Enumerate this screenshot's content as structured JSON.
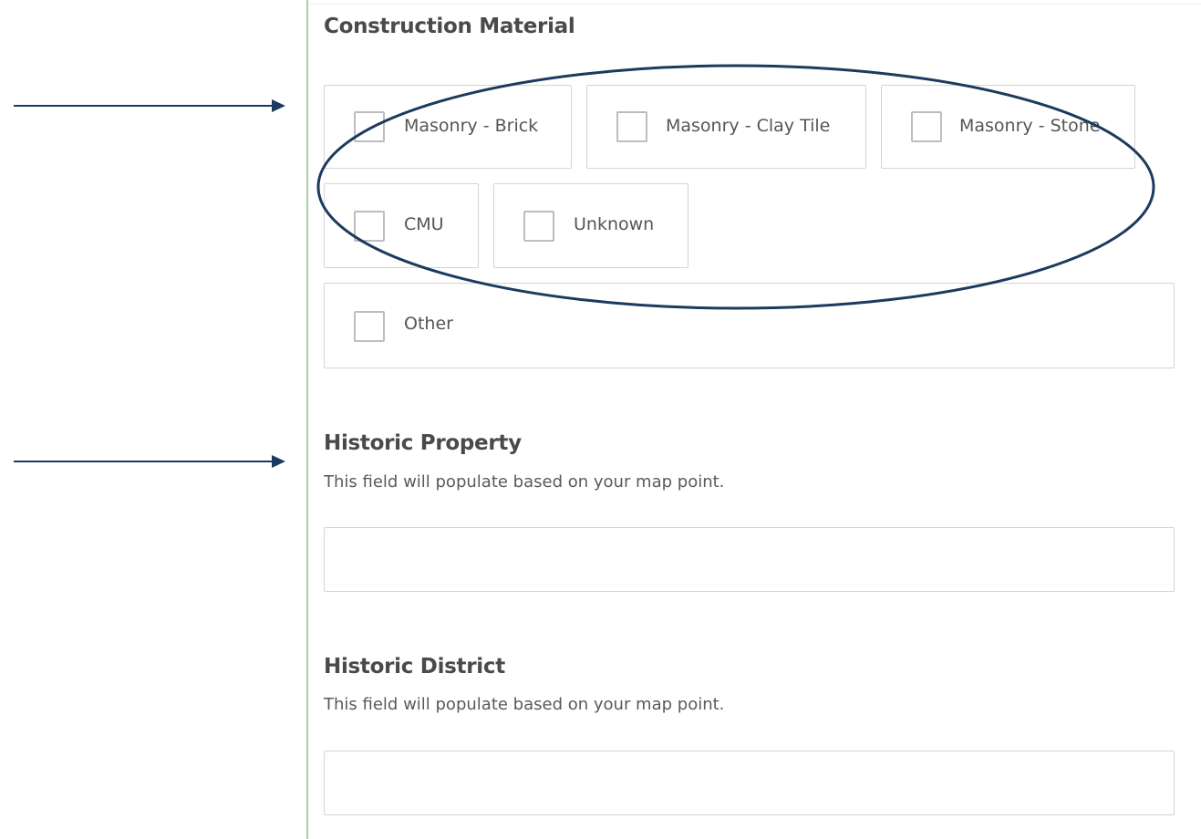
{
  "sections": {
    "construction_material": {
      "title": "Construction Material",
      "options": [
        {
          "label": "Masonry - Brick",
          "checked": false
        },
        {
          "label": "Masonry - Clay Tile",
          "checked": false
        },
        {
          "label": "Masonry - Stone",
          "checked": false
        },
        {
          "label": "CMU",
          "checked": false
        },
        {
          "label": "Unknown",
          "checked": false
        },
        {
          "label": "Other",
          "checked": false
        }
      ]
    },
    "historic_property": {
      "title": "Historic Property",
      "helper": "This field will populate based on your map point.",
      "value": "",
      "placeholder": ""
    },
    "historic_district": {
      "title": "Historic District",
      "helper": "This field will populate based on your map point.",
      "value": "",
      "placeholder": ""
    }
  },
  "annotations": {
    "color": "#1c3a5e",
    "shapes": [
      "arrow-right",
      "arrow-right",
      "ellipse"
    ]
  },
  "theme": {
    "accent_rule_color": "#a7d3a1",
    "border_color": "#d4d4d4"
  }
}
